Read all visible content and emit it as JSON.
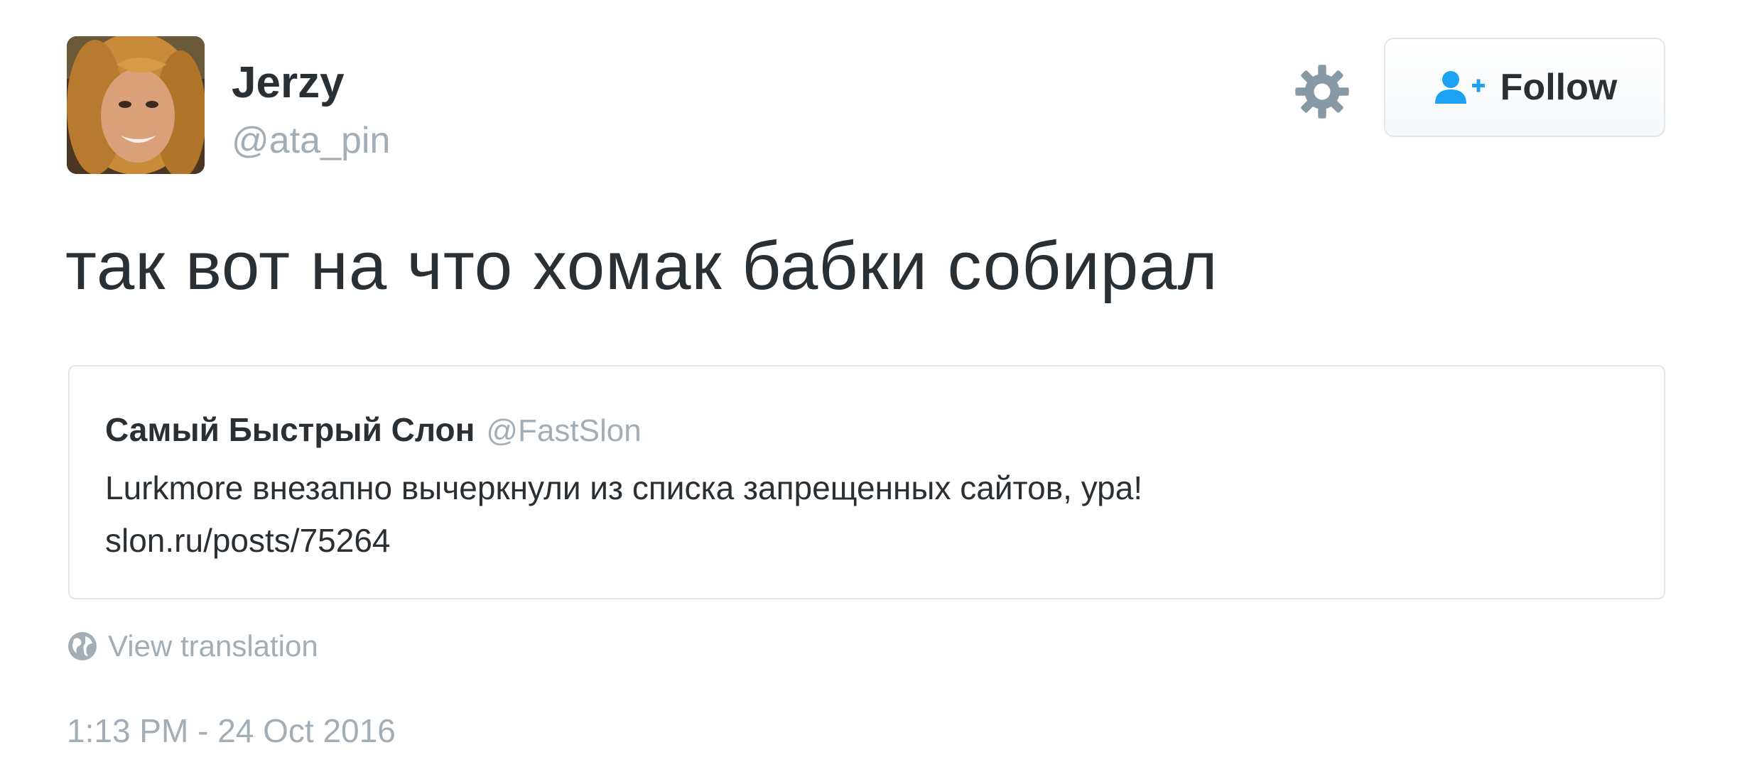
{
  "author": {
    "name": "Jerzy",
    "handle": "@ata_pin",
    "avatar_icon": "user-avatar-photo"
  },
  "actions": {
    "settings_icon": "gear-icon",
    "follow_label": "Follow",
    "follow_icon": "add-user-icon",
    "accent_color": "#1da1f2"
  },
  "tweet": {
    "text": "так вот на что хомак бабки собирал"
  },
  "quoted_tweet": {
    "author_name": "Самый Быстрый Слон",
    "author_handle": "@FastSlon",
    "text": "Lurkmore внезапно вычеркнули из списка запрещенных сайтов, ура!",
    "link": "slon.ru/posts/75264"
  },
  "translate": {
    "icon": "globe-icon",
    "label": "View translation"
  },
  "timestamp": "1:13 PM - 24 Oct 2016"
}
